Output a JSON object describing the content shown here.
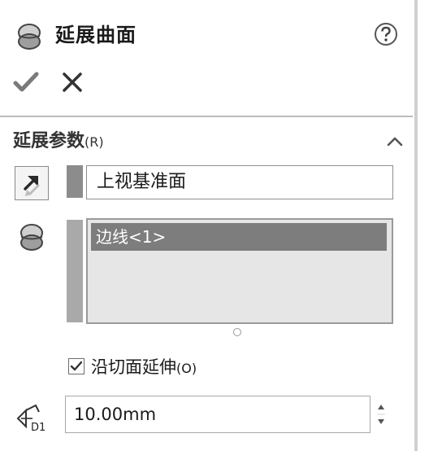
{
  "header": {
    "title": "延展曲面",
    "icons": {
      "feature": "extended-surface-icon",
      "help": "help-circle-icon"
    }
  },
  "actions": {
    "ok_icon": "checkmark-icon",
    "cancel_icon": "x-close-icon"
  },
  "section": {
    "title": "延展参数",
    "shortcut": "(R)",
    "collapse_icon": "chevron-up-icon"
  },
  "plane": {
    "value": "上视基准面",
    "direction_icon": "reverse-direction-icon"
  },
  "edges": {
    "items": [
      "边线<1>"
    ],
    "icon": "edge-selection-icon"
  },
  "tangent_option": {
    "label": "沿切面延伸",
    "shortcut": "(O)",
    "checked": true
  },
  "distance": {
    "value": "10.00mm",
    "icon": "distance-d1-icon",
    "icon_text": "D1"
  }
}
